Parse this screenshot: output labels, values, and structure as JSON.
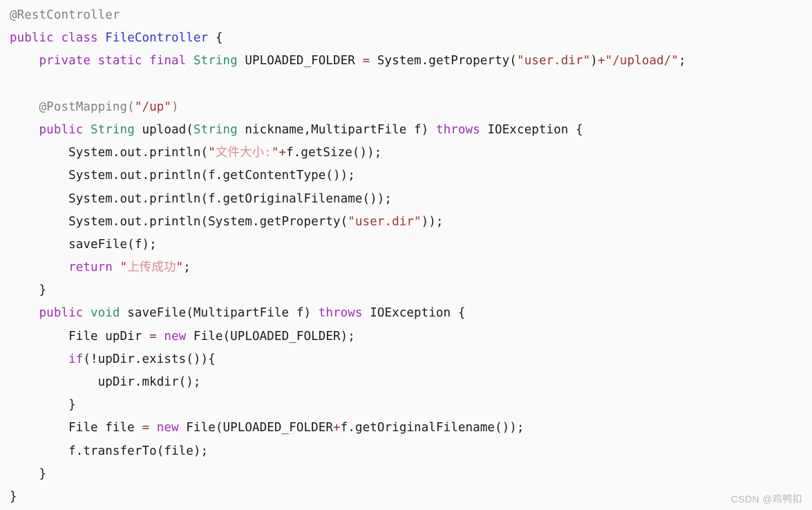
{
  "editor": {
    "language": "java",
    "background_color": "#fafafa",
    "default_text_color": "#1a1a1a",
    "token_colors": {
      "keyword": "#9b30b0",
      "type": "#2e8b77",
      "class_name": "#3333cc",
      "annotation": "#808080",
      "string": "#a03434",
      "string_cjk": "#d98a95",
      "operator": "#8a3b2e",
      "plain": "#1a1a1a"
    },
    "code_lines": [
      {
        "indent": 0,
        "tokens": [
          {
            "t": "@RestController",
            "c": "ann"
          }
        ]
      },
      {
        "indent": 0,
        "tokens": [
          {
            "t": "public",
            "c": "kw"
          },
          {
            "t": " ",
            "c": "pln"
          },
          {
            "t": "class",
            "c": "kw"
          },
          {
            "t": " ",
            "c": "pln"
          },
          {
            "t": "FileController",
            "c": "cls"
          },
          {
            "t": " {",
            "c": "pln"
          }
        ]
      },
      {
        "indent": 1,
        "tokens": [
          {
            "t": "private",
            "c": "kw"
          },
          {
            "t": " ",
            "c": "pln"
          },
          {
            "t": "static",
            "c": "kw"
          },
          {
            "t": " ",
            "c": "pln"
          },
          {
            "t": "final",
            "c": "kw"
          },
          {
            "t": " ",
            "c": "pln"
          },
          {
            "t": "String",
            "c": "type"
          },
          {
            "t": " UPLOADED_FOLDER ",
            "c": "pln"
          },
          {
            "t": "=",
            "c": "op"
          },
          {
            "t": " System.getProperty(",
            "c": "pln"
          },
          {
            "t": "\"user.dir\"",
            "c": "str"
          },
          {
            "t": ")",
            "c": "pln"
          },
          {
            "t": "+",
            "c": "op"
          },
          {
            "t": "\"/upload/\"",
            "c": "str"
          },
          {
            "t": ";",
            "c": "pln"
          }
        ]
      },
      {
        "indent": 0,
        "tokens": []
      },
      {
        "indent": 1,
        "tokens": [
          {
            "t": "@PostMapping(",
            "c": "ann"
          },
          {
            "t": "\"/up\"",
            "c": "str"
          },
          {
            "t": ")",
            "c": "ann"
          }
        ]
      },
      {
        "indent": 1,
        "tokens": [
          {
            "t": "public",
            "c": "kw"
          },
          {
            "t": " ",
            "c": "pln"
          },
          {
            "t": "String",
            "c": "type"
          },
          {
            "t": " upload(",
            "c": "pln"
          },
          {
            "t": "String",
            "c": "type"
          },
          {
            "t": " nickname,MultipartFile f) ",
            "c": "pln"
          },
          {
            "t": "throws",
            "c": "kw"
          },
          {
            "t": " IOException {",
            "c": "pln"
          }
        ]
      },
      {
        "indent": 2,
        "tokens": [
          {
            "t": "System.out.println(",
            "c": "pln"
          },
          {
            "t": "\"",
            "c": "str"
          },
          {
            "t": "文件大小:",
            "c": "strc"
          },
          {
            "t": "\"",
            "c": "str"
          },
          {
            "t": "+",
            "c": "op"
          },
          {
            "t": "f.getSize());",
            "c": "pln"
          }
        ]
      },
      {
        "indent": 2,
        "tokens": [
          {
            "t": "System.out.println(f.getContentType());",
            "c": "pln"
          }
        ]
      },
      {
        "indent": 2,
        "tokens": [
          {
            "t": "System.out.println(f.getOriginalFilename());",
            "c": "pln"
          }
        ]
      },
      {
        "indent": 2,
        "tokens": [
          {
            "t": "System.out.println(System.getProperty(",
            "c": "pln"
          },
          {
            "t": "\"user.dir\"",
            "c": "str"
          },
          {
            "t": "));",
            "c": "pln"
          }
        ]
      },
      {
        "indent": 2,
        "tokens": [
          {
            "t": "saveFile(f);",
            "c": "pln"
          }
        ]
      },
      {
        "indent": 2,
        "tokens": [
          {
            "t": "return",
            "c": "kw"
          },
          {
            "t": " ",
            "c": "pln"
          },
          {
            "t": "\"",
            "c": "str"
          },
          {
            "t": "上传成功",
            "c": "strc"
          },
          {
            "t": "\"",
            "c": "str"
          },
          {
            "t": ";",
            "c": "pln"
          }
        ]
      },
      {
        "indent": 1,
        "tokens": [
          {
            "t": "}",
            "c": "pln"
          }
        ]
      },
      {
        "indent": 1,
        "tokens": [
          {
            "t": "public",
            "c": "kw"
          },
          {
            "t": " ",
            "c": "pln"
          },
          {
            "t": "void",
            "c": "type"
          },
          {
            "t": " saveFile(MultipartFile f) ",
            "c": "pln"
          },
          {
            "t": "throws",
            "c": "kw"
          },
          {
            "t": " IOException {",
            "c": "pln"
          }
        ]
      },
      {
        "indent": 2,
        "tokens": [
          {
            "t": "File upDir ",
            "c": "pln"
          },
          {
            "t": "=",
            "c": "op"
          },
          {
            "t": " ",
            "c": "pln"
          },
          {
            "t": "new",
            "c": "kw"
          },
          {
            "t": " File(UPLOADED_FOLDER);",
            "c": "pln"
          }
        ]
      },
      {
        "indent": 2,
        "tokens": [
          {
            "t": "if",
            "c": "kw"
          },
          {
            "t": "(!upDir.exists()){",
            "c": "pln"
          }
        ]
      },
      {
        "indent": 3,
        "tokens": [
          {
            "t": "upDir.mkdir();",
            "c": "pln"
          }
        ]
      },
      {
        "indent": 2,
        "tokens": [
          {
            "t": "}",
            "c": "pln"
          }
        ]
      },
      {
        "indent": 2,
        "tokens": [
          {
            "t": "File file ",
            "c": "pln"
          },
          {
            "t": "=",
            "c": "op"
          },
          {
            "t": " ",
            "c": "pln"
          },
          {
            "t": "new",
            "c": "kw"
          },
          {
            "t": " File(UPLOADED_FOLDER",
            "c": "pln"
          },
          {
            "t": "+",
            "c": "op"
          },
          {
            "t": "f.getOriginalFilename());",
            "c": "pln"
          }
        ]
      },
      {
        "indent": 2,
        "tokens": [
          {
            "t": "f.transferTo(file);",
            "c": "pln"
          }
        ]
      },
      {
        "indent": 1,
        "tokens": [
          {
            "t": "}",
            "c": "pln"
          }
        ]
      },
      {
        "indent": 0,
        "tokens": [
          {
            "t": "}",
            "c": "pln"
          }
        ]
      }
    ]
  },
  "watermark": {
    "text": "CSDN @鸡鸭扣"
  }
}
